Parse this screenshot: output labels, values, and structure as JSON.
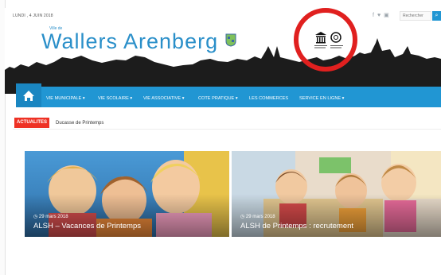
{
  "topbar": {
    "date": "LUNDI , 4 JUIN 2018",
    "social_icons": [
      "facebook-icon",
      "twitter-icon",
      "instagram-icon"
    ],
    "search_placeholder": "Rechercher"
  },
  "header": {
    "ville_de": "Ville de",
    "title": "Wallers Arenberg",
    "brand_color": "#2a8fc9",
    "highlight_circle_color": "#e0201f"
  },
  "nav": {
    "home_icon": "home-icon",
    "items": [
      {
        "label": "VIE MUNICIPALE ▾"
      },
      {
        "label": "VIE SCOLAIRE ▾"
      },
      {
        "label": "VIE ASSOCIATIVE ▾"
      },
      {
        "label": "COTE PRATIQUE ▾"
      },
      {
        "label": "LES COMMERCES"
      },
      {
        "label": "SERVICE EN LIGNE ▾"
      }
    ],
    "color": "#2196d3"
  },
  "ticker": {
    "label": "ACTUALITES",
    "text": "Ducasse de Printemps"
  },
  "cards": [
    {
      "date": "◷ 29 mars 2018",
      "title": "ALSH – Vacances de Printemps"
    },
    {
      "date": "◷ 29 mars 2018",
      "title": "ALSH de Printemps : recrutement"
    }
  ]
}
